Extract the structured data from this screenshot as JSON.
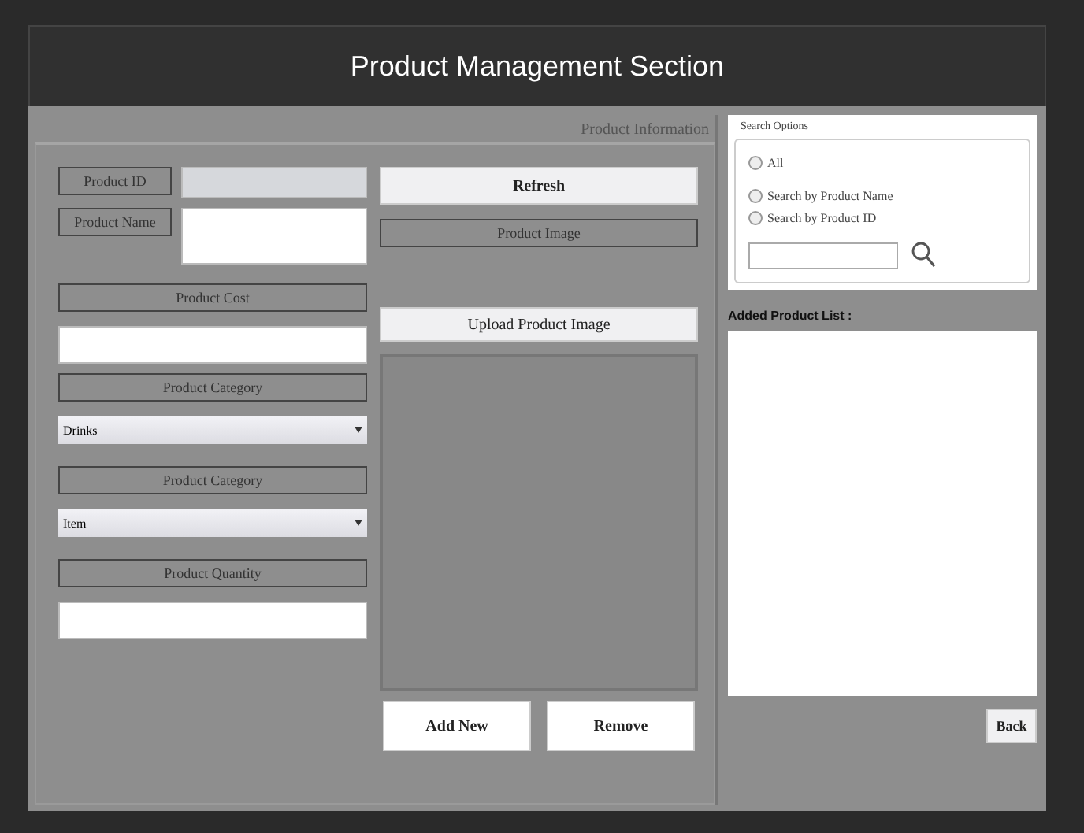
{
  "window": {
    "title": "Product Management Section"
  },
  "product_information": {
    "legend": "Product Information",
    "fields": [
      {
        "kind": "text",
        "label": "Product ID",
        "disabled": true
      },
      {
        "kind": "textarea",
        "label": "Product Name",
        "disabled": false
      }
    ],
    "stacked": [
      {
        "kind": "text",
        "label": "Product Cost"
      },
      {
        "kind": "select",
        "label": "Product Category",
        "value": "Drinks"
      },
      {
        "kind": "select",
        "label": "Product Category",
        "value": "Item"
      },
      {
        "kind": "text",
        "label": "Product Quantity"
      }
    ],
    "refresh_button": "Refresh",
    "image_label": "Product Image",
    "upload_button": "Upload Product Image",
    "actions": [
      "Add New",
      "Remove"
    ]
  },
  "search_options": {
    "legend": "Search Options",
    "radios": [
      {
        "label": "All",
        "selected": false
      },
      {
        "label": "Search by Product Name",
        "selected": false
      },
      {
        "label": "Search by Product ID",
        "selected": false
      }
    ]
  },
  "product_list": {
    "label": "Added Product List :"
  },
  "back_button": "Back"
}
